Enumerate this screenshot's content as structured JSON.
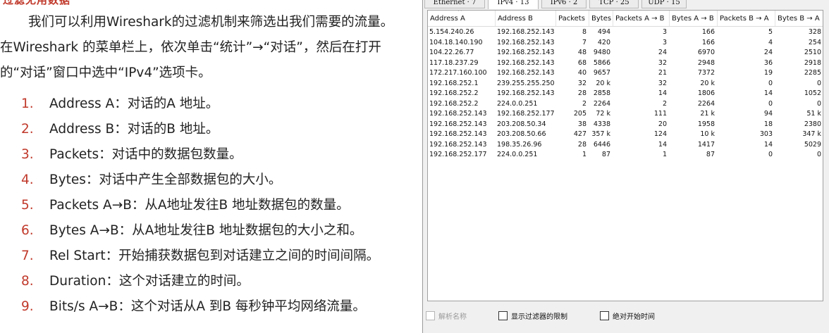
{
  "article": {
    "heading": "过滤无用数据",
    "paragraph": "我们可以利用Wireshark的过滤机制来筛选出我们需要的流量。在Wireshark 的菜单栏上，依次单击“统计”→“对话”，然后在打开的“对话”窗口中选中“IPv4”选项卡。",
    "items": [
      {
        "num": "1.",
        "text": "Address A：对话的A 地址。"
      },
      {
        "num": "2.",
        "text": "Address B：对话的B 地址。"
      },
      {
        "num": "3.",
        "text": "Packets：对话中的数据包数量。"
      },
      {
        "num": "4.",
        "text": "Bytes：对话中产生全部数据包的大小。"
      },
      {
        "num": "5.",
        "text": "Packets A→B：从A地址发往B 地址数据包的数量。"
      },
      {
        "num": "6.",
        "text": "Bytes A→B：从A地址发往B 地址数据包的大小之和。"
      },
      {
        "num": "7.",
        "text": "Rel Start：开始捕获数据包到对话建立之间的时间间隔。"
      },
      {
        "num": "8.",
        "text": "Duration：这个对话建立的时间。"
      },
      {
        "num": "9.",
        "text": "Bits/s A→B：这个对话从A 到B 每秒钟平均网络流量。"
      }
    ]
  },
  "dialog": {
    "tabs": [
      {
        "label": "Ethernet · 7",
        "active": false
      },
      {
        "label": "IPv4 · 13",
        "active": true
      },
      {
        "label": "IPv6 · 2",
        "active": false
      },
      {
        "label": "TCP · 25",
        "active": false
      },
      {
        "label": "UDP · 15",
        "active": false
      }
    ],
    "columns": [
      "Address A",
      "Address B",
      "Packets",
      "Bytes",
      "Packets A → B",
      "Bytes A → B",
      "Packets B → A",
      "Bytes B → A"
    ],
    "rows": [
      [
        "5.154.240.26",
        "192.168.252.143",
        "8",
        "494",
        "3",
        "166",
        "5",
        "328"
      ],
      [
        "104.18.140.190",
        "192.168.252.143",
        "7",
        "420",
        "3",
        "166",
        "4",
        "254"
      ],
      [
        "104.22.26.77",
        "192.168.252.143",
        "48",
        "9480",
        "24",
        "6970",
        "24",
        "2510"
      ],
      [
        "117.18.237.29",
        "192.168.252.143",
        "68",
        "5866",
        "32",
        "2948",
        "36",
        "2918"
      ],
      [
        "172.217.160.100",
        "192.168.252.143",
        "40",
        "9657",
        "21",
        "7372",
        "19",
        "2285"
      ],
      [
        "192.168.252.1",
        "239.255.255.250",
        "32",
        "20 k",
        "32",
        "20 k",
        "0",
        "0"
      ],
      [
        "192.168.252.2",
        "192.168.252.143",
        "28",
        "2858",
        "14",
        "1806",
        "14",
        "1052"
      ],
      [
        "192.168.252.2",
        "224.0.0.251",
        "2",
        "2264",
        "2",
        "2264",
        "0",
        "0"
      ],
      [
        "192.168.252.143",
        "192.168.252.177",
        "205",
        "72 k",
        "111",
        "21 k",
        "94",
        "51 k"
      ],
      [
        "192.168.252.143",
        "203.208.50.34",
        "38",
        "4338",
        "20",
        "1958",
        "18",
        "2380"
      ],
      [
        "192.168.252.143",
        "203.208.50.66",
        "427",
        "357 k",
        "124",
        "10 k",
        "303",
        "347 k"
      ],
      [
        "192.168.252.143",
        "198.35.26.96",
        "28",
        "6446",
        "14",
        "1417",
        "14",
        "5029"
      ],
      [
        "192.168.252.177",
        "224.0.0.251",
        "1",
        "87",
        "1",
        "87",
        "0",
        "0"
      ]
    ],
    "checkboxes": [
      {
        "label": "解析名称",
        "checked": false,
        "enabled": false
      },
      {
        "label": "显示过滤器的限制",
        "checked": false,
        "enabled": true
      },
      {
        "label": "绝对开始时间",
        "checked": false,
        "enabled": true
      }
    ]
  }
}
